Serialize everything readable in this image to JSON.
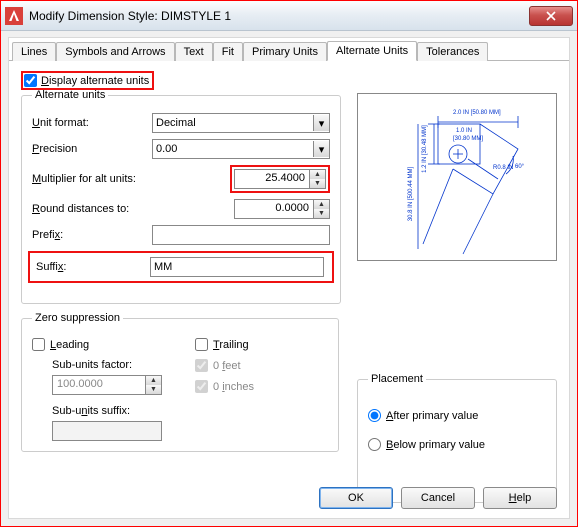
{
  "window": {
    "title": "Modify Dimension Style: DIMSTYLE 1"
  },
  "tabs": [
    "Lines",
    "Symbols and Arrows",
    "Text",
    "Fit",
    "Primary Units",
    "Alternate Units",
    "Tolerances"
  ],
  "active_tab": "Alternate Units",
  "display_alt_units": {
    "label": "Display alternate units",
    "checked": true
  },
  "alt_units_group": "Alternate units",
  "unit_format": {
    "label": "Unit format:",
    "value": "Decimal"
  },
  "precision": {
    "label": "Precision",
    "value": "0.00"
  },
  "multiplier": {
    "label": "Multiplier for alt units:",
    "value": "25.4000"
  },
  "round": {
    "label": "Round distances to:",
    "value": "0.0000"
  },
  "prefix": {
    "label": "Prefix:",
    "value": ""
  },
  "suffix": {
    "label": "Suffix:",
    "value": "MM"
  },
  "zero_group": "Zero suppression",
  "zero": {
    "leading": {
      "label": "Leading",
      "checked": false
    },
    "trailing": {
      "label": "Trailing",
      "checked": false
    },
    "sub_factor_label": "Sub-units factor:",
    "sub_factor_value": "100.0000",
    "sub_suffix_label": "Sub-units suffix:",
    "sub_suffix_value": "",
    "feet": {
      "label": "0 feet",
      "checked": true
    },
    "inches": {
      "label": "0 inches",
      "checked": true
    }
  },
  "placement_group": "Placement",
  "placement": {
    "after": {
      "label": "After primary value",
      "selected": true
    },
    "below": {
      "label": "Below primary value",
      "selected": false
    }
  },
  "buttons": {
    "ok": "OK",
    "cancel": "Cancel",
    "help": "Help"
  },
  "preview": {
    "labels": [
      "2.0 IN [50.80 MM]",
      "1.0 IN",
      "30.80 MM",
      "R0.8 IN",
      "60°",
      "1.2 IN [30.48 MM]",
      "30.8 IN [500.44 MM]"
    ]
  }
}
